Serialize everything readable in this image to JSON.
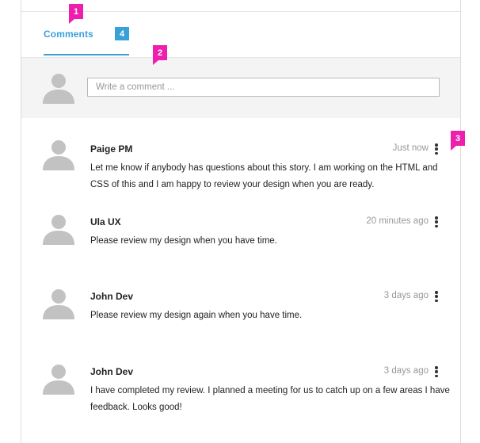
{
  "tabs": {
    "comments_label": "Comments",
    "comments_count": "4"
  },
  "composer": {
    "placeholder": "Write a comment ..."
  },
  "comments": [
    {
      "author": "Paige PM",
      "time": "Just now",
      "text": "Let me know if anybody has questions about this story. I am working on the HTML and CSS of this and I am happy to review your design when you are ready."
    },
    {
      "author": "Ula UX",
      "time": "20 minutes ago",
      "text": "Please review my design when you have time."
    },
    {
      "author": "John Dev",
      "time": "3 days ago",
      "text": "Please review my design again when you have time."
    },
    {
      "author": "John Dev",
      "time": "3 days ago",
      "text": "I have completed my review. I planned a meeting for us to catch up on a few areas I have feedback. Looks good!"
    }
  ],
  "markers": [
    "1",
    "2",
    "3"
  ],
  "colors": {
    "accent": "#3aa0d8",
    "marker": "#ee1fad",
    "avatar": "#c2c2c2",
    "compose_bg": "#f4f4f4"
  },
  "icons": {
    "avatar": "user-silhouette-icon",
    "more": "vertical-ellipsis-icon"
  }
}
